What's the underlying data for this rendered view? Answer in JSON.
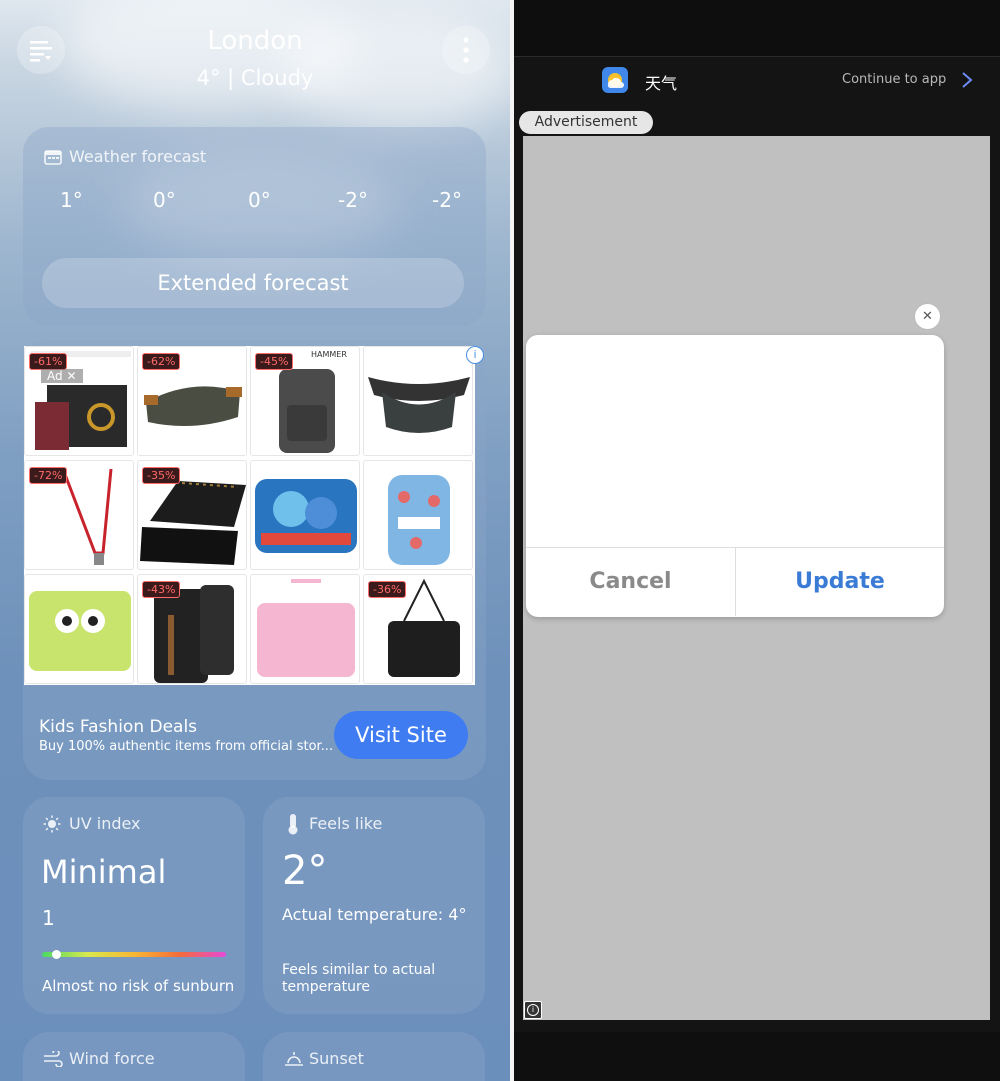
{
  "left": {
    "city": "London",
    "condition": "4° | Cloudy",
    "forecast": {
      "title": "Weather forecast",
      "temps": [
        "1°",
        "0°",
        "0°",
        "-2°",
        "-2°"
      ],
      "extended_label": "Extended forecast"
    },
    "ad": {
      "badge": "Ad",
      "close": "✕",
      "info": "i",
      "discounts": [
        "-61%",
        "-62%",
        "-45%",
        "-72%",
        "-35%",
        "-43%",
        "-36%"
      ],
      "title": "Kids Fashion Deals",
      "subtitle": "Buy 100% authentic items from official stor...",
      "cta": "Visit Site"
    },
    "uv": {
      "label": "UV index",
      "level": "Minimal",
      "value": "1",
      "note": "Almost no risk of sunburn",
      "indicator_fraction": 0.08
    },
    "feels": {
      "label": "Feels like",
      "value": "2°",
      "actual": "Actual temperature: 4°",
      "note": "Feels similar to actual temperature"
    },
    "wind": {
      "label": "Wind force"
    },
    "sunset": {
      "label": "Sunset"
    }
  },
  "right": {
    "app_name": "天气",
    "continue": "Continue to app",
    "advertisement": "Advertisement",
    "dialog": {
      "cancel": "Cancel",
      "update": "Update",
      "close": "✕"
    },
    "info_icon": "i"
  },
  "colors": {
    "accent_blue": "#3f7cf2",
    "update_blue": "#3a7bd5",
    "dark_bg": "#141414",
    "ad_gray": "#c0c0c0"
  }
}
